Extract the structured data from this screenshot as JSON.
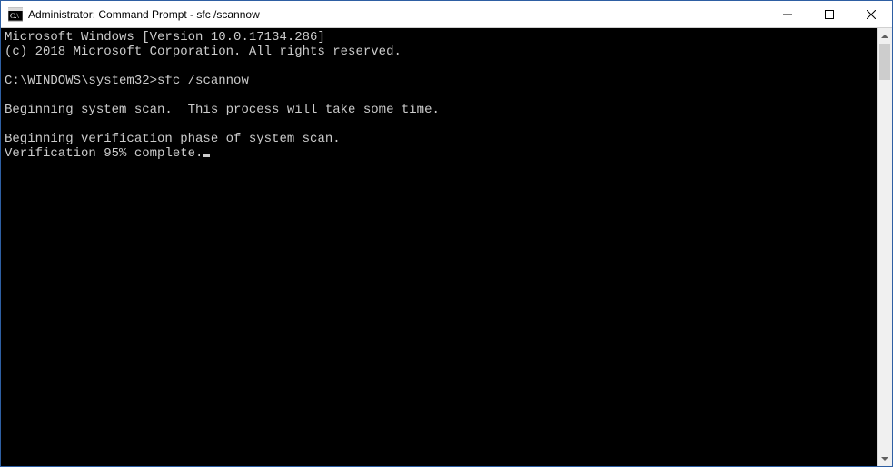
{
  "window": {
    "title": "Administrator: Command Prompt - sfc  /scannow"
  },
  "console": {
    "line_version": "Microsoft Windows [Version 10.0.17134.286]",
    "line_copyright": "(c) 2018 Microsoft Corporation. All rights reserved.",
    "prompt_path": "C:\\WINDOWS\\system32>",
    "prompt_command": "sfc /scannow",
    "line_begin_scan": "Beginning system scan.  This process will take some time.",
    "line_verify_phase": "Beginning verification phase of system scan.",
    "verify_prefix": "Verification ",
    "verify_percent": "95",
    "verify_suffix": "% complete."
  }
}
